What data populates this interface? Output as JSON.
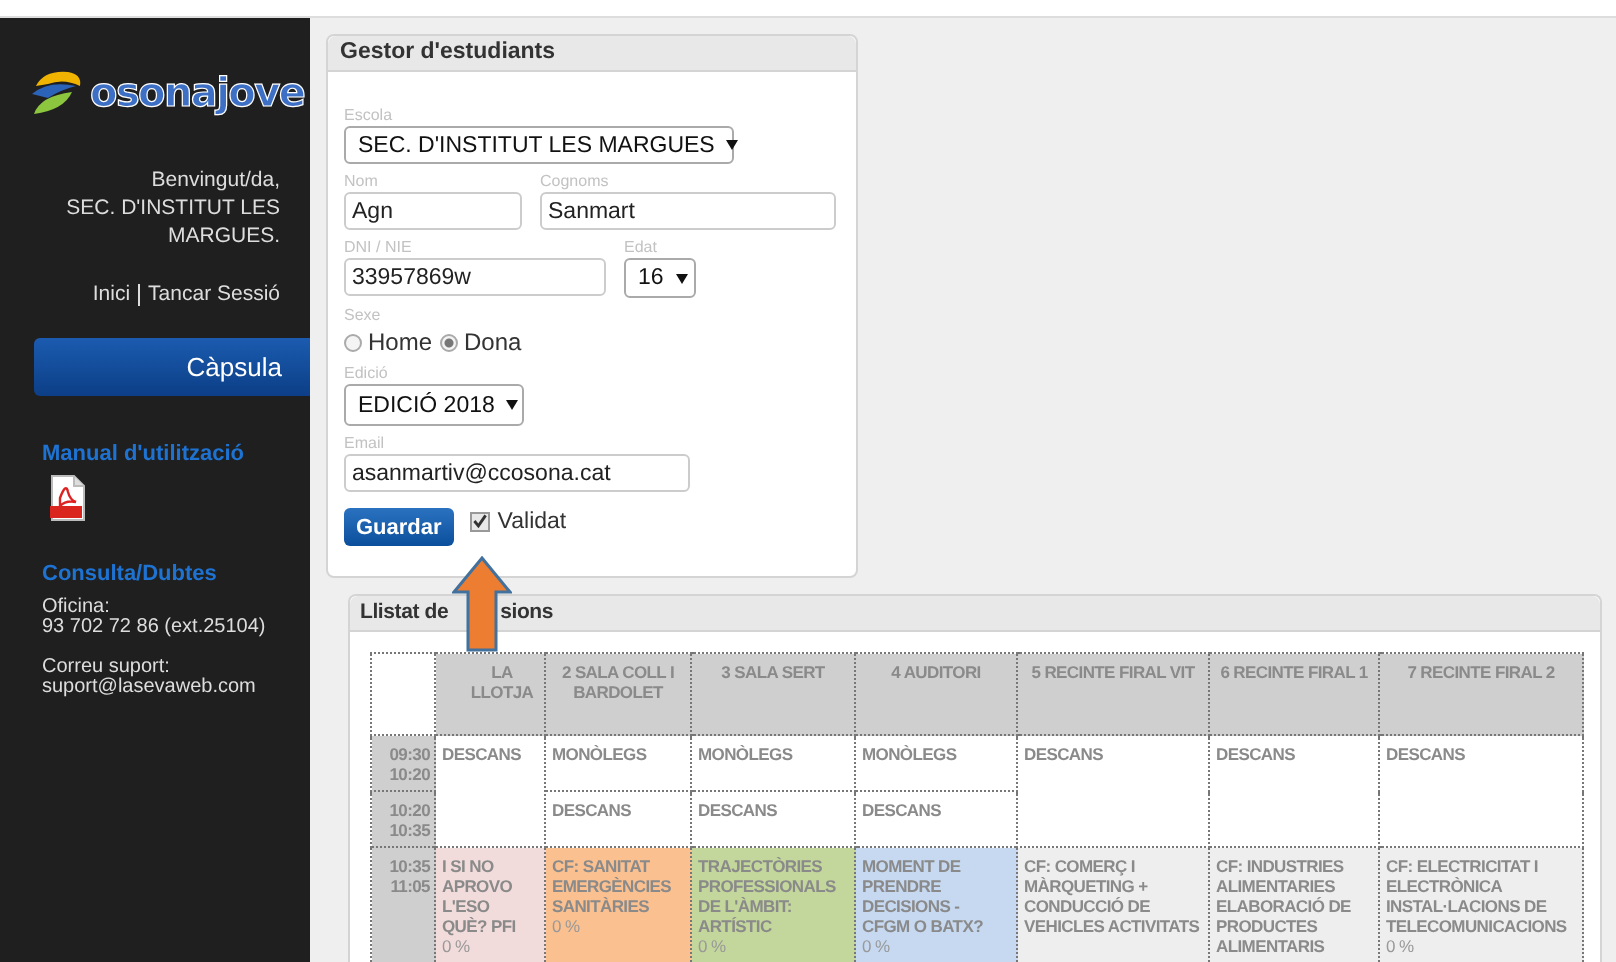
{
  "sidebar": {
    "logo": "osonajove",
    "welcome": [
      "Benvingut/da,",
      "SEC. D'INSTITUT LES MARGUES."
    ],
    "links": [
      "Inici",
      "Tancar Sessió"
    ],
    "nav_button": "Càpsula",
    "manual_title": "Manual d'utilització",
    "contact_title": "Consulta/Dubtes",
    "contact": [
      {
        "label": "Oficina:",
        "value": "93 702 72 86 (ext.25104)"
      },
      {
        "label": "Correu suport:",
        "value": "suport@lasevaweb.com"
      }
    ]
  },
  "student_form": {
    "title": "Gestor d'estudiants",
    "school": {
      "label": "Escola",
      "value": "SEC. D'INSTITUT LES MARGUES"
    },
    "first_name": {
      "label": "Nom",
      "value": "Agn"
    },
    "surname": {
      "label": "Cognoms",
      "value": "Sanmart"
    },
    "id": {
      "label": "DNI / NIE",
      "value": "33957869w"
    },
    "age": {
      "label": "Edat",
      "value": "16"
    },
    "sex": {
      "label": "Sexe",
      "options": [
        {
          "label": "Home",
          "selected": false
        },
        {
          "label": "Dona",
          "selected": true
        }
      ]
    },
    "edition": {
      "label": "Edició",
      "value": "EDICIÓ 2018"
    },
    "email": {
      "label": "Email",
      "value": "asanmartiv@ccosona.cat"
    },
    "save_button": "Guardar",
    "validated": {
      "label": "Validat",
      "checked": true
    }
  },
  "sessions": {
    "title_parts": [
      "Llistat de",
      "sions"
    ],
    "columns": [
      "LA LLOTJA",
      "2 SALA COLL I BARDOLET",
      "3 SALA SERT",
      "4 AUDITORI",
      "5 RECINTE FIRAL VIT",
      "6 RECINTE FIRAL 1",
      "7 RECINTE FIRAL 2"
    ],
    "rows": [
      {
        "start": "09:30",
        "end": "10:20",
        "cells": [
          {
            "text": "DESCANS",
            "rowspan": 2
          },
          {
            "text": "MONÒLEGS"
          },
          {
            "text": "MONÒLEGS"
          },
          {
            "text": "MONÒLEGS"
          },
          {
            "text": "DESCANS",
            "rowspan": 2
          },
          {
            "text": "DESCANS",
            "rowspan": 2
          },
          {
            "text": "DESCANS",
            "rowspan": 2
          }
        ]
      },
      {
        "start": "10:20",
        "end": "10:35",
        "cells": [
          {
            "text": "DESCANS"
          },
          {
            "text": "DESCANS"
          },
          {
            "text": "DESCANS"
          }
        ]
      },
      {
        "start": "10:35",
        "end": "11:05",
        "cells": [
          {
            "text": "I SI NO APROVO L'ESO QUÈ? PFI",
            "percent": "0 %",
            "color": "#f2dcdb"
          },
          {
            "text": "CF: SANITAT EMERGÈNCIES SANITÀRIES",
            "percent": "0 %",
            "color": "#fac090"
          },
          {
            "text": "TRAJECTÒRIES PROFESSIONALS DE L'ÀMBIT: ARTÍSTIC",
            "percent": "0 %",
            "color": "#c3d69b"
          },
          {
            "text": "MOMENT DE PRENDRE DECISIONS - CFGM O BATX?",
            "percent": "0 %",
            "color": "#c6d9f1"
          },
          {
            "text": "CF: COMERÇ I MÀRQUETING + CONDUCCIÓ DE VEHICLES ACTIVITATS",
            "color": "#eeeeee"
          },
          {
            "text": "CF: INDUSTRIES ALIMENTARIES ELABORACIÓ DE PRODUCTES ALIMENTARIS",
            "color": "#eeeeee"
          },
          {
            "text": "CF: ELECTRICITAT I ELECTRÒNICA INSTAL·LACIONS DE TELECOMUNICACIONS",
            "percent": "0 %",
            "color": "#eeeeee"
          }
        ]
      }
    ]
  }
}
